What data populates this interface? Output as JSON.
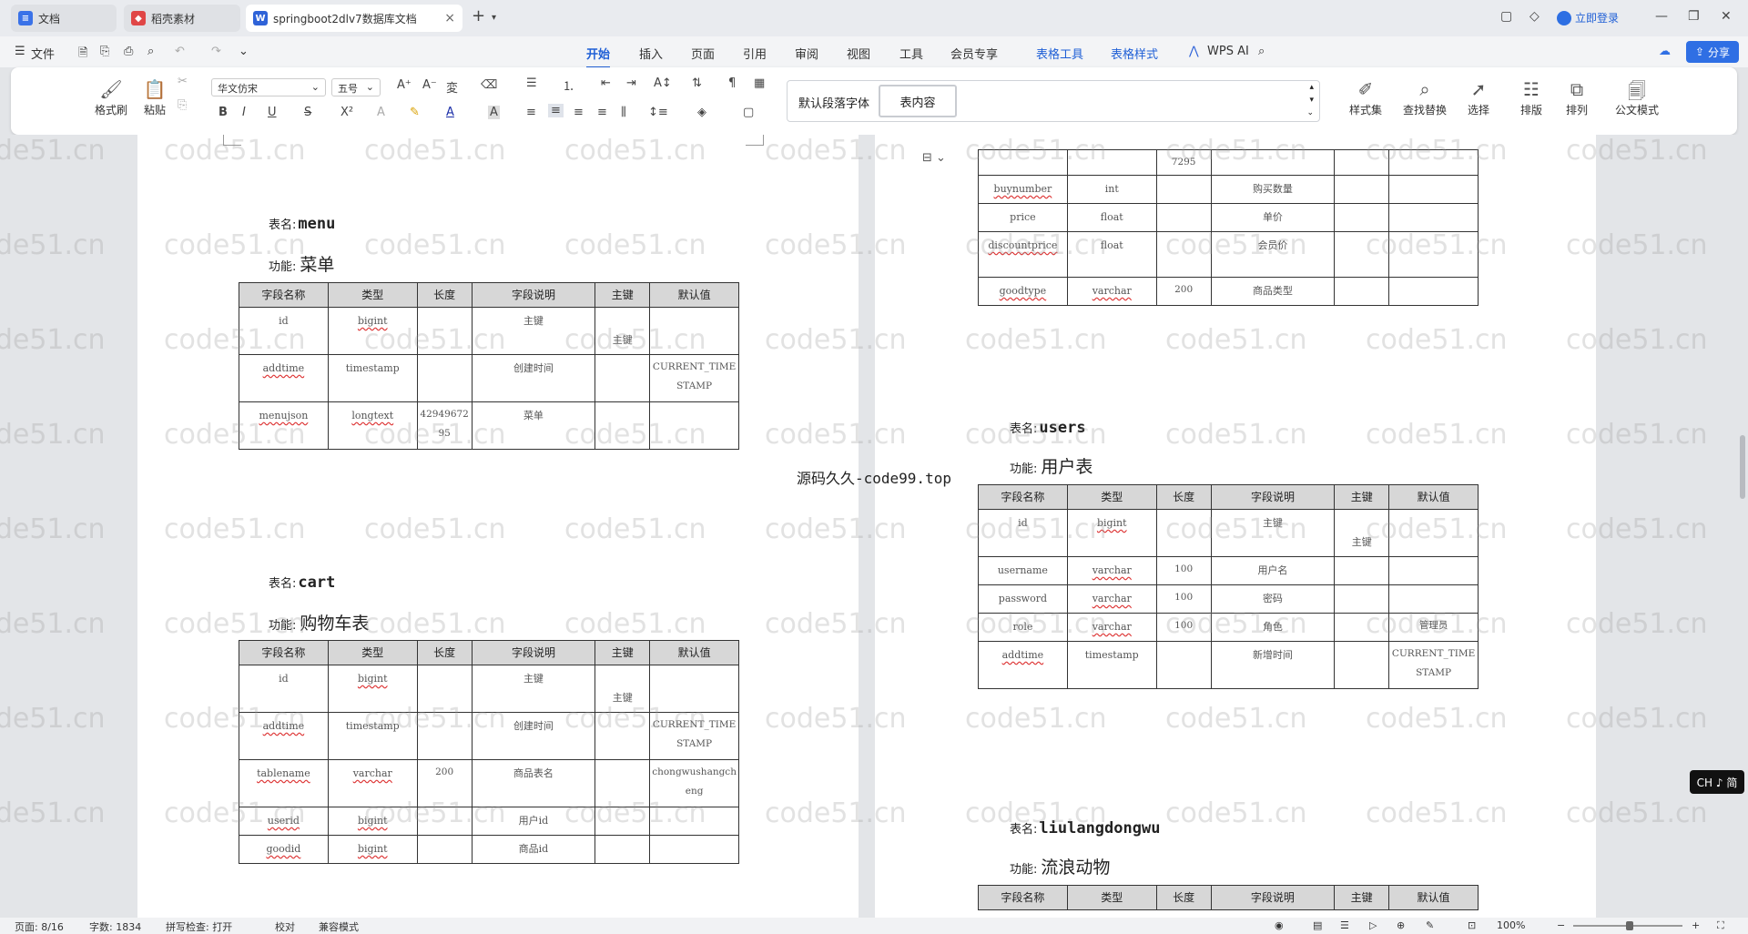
{
  "tabs": [
    {
      "label": "文档",
      "icon": "docs-icon",
      "color": "#3a72e8"
    },
    {
      "label": "稻壳素材",
      "icon": "docer-icon",
      "color": "#e04646"
    },
    {
      "label": "springboot2dlv7数据库文档",
      "icon": "word-icon",
      "color": "#2f63d8"
    }
  ],
  "titlebar": {
    "login": "立即登录"
  },
  "menu": {
    "file": "文件",
    "items": [
      "开始",
      "插入",
      "页面",
      "引用",
      "审阅",
      "视图",
      "工具",
      "会员专享",
      "表格工具",
      "表格样式"
    ],
    "wps_ai": "WPS AI",
    "share": "分享"
  },
  "ribbon": {
    "format_painter": "格式刷",
    "paste": "粘贴",
    "font_name": "华文仿宋",
    "font_size": "五号",
    "default_para_font": "默认段落字体",
    "table_content": "表内容",
    "styles": "样式集",
    "find_replace": "查找替换",
    "select": "选择",
    "layout": "排版",
    "arrange": "排列",
    "official_mode": "公文模式"
  },
  "watermark": "code51.cn",
  "middle_text": "源码久久-code99.top",
  "headers": [
    "字段名称",
    "类型",
    "长度",
    "字段说明",
    "主键",
    "默认值"
  ],
  "labels": {
    "table_name": "表名:",
    "function": "功能:"
  },
  "left": {
    "menu": {
      "name": "menu",
      "func": "菜单",
      "rows": [
        [
          "id",
          "bigint",
          "",
          "主键",
          "主键",
          ""
        ],
        [
          "addtime",
          "timestamp",
          "",
          "创建时间",
          "",
          "CURRENT_TIMESTAMP"
        ],
        [
          "menujson",
          "longtext",
          "4294967295",
          "菜单",
          "",
          ""
        ]
      ]
    },
    "cart": {
      "name": "cart",
      "func": "购物车表",
      "rows": [
        [
          "id",
          "bigint",
          "",
          "主键",
          "主键",
          ""
        ],
        [
          "addtime",
          "timestamp",
          "",
          "创建时间",
          "",
          "CURRENT_TIMESTAMP"
        ],
        [
          "tablename",
          "varchar",
          "200",
          "商品表名",
          "",
          "chongwushangcheng"
        ],
        [
          "userid",
          "bigint",
          "",
          "用户id",
          "",
          ""
        ],
        [
          "goodid",
          "bigint",
          "",
          "商品id",
          "",
          ""
        ]
      ]
    }
  },
  "right": {
    "cont": {
      "rows": [
        [
          "",
          "",
          "7295",
          "",
          "",
          ""
        ],
        [
          "buynumber",
          "int",
          "",
          "购买数量",
          "",
          ""
        ],
        [
          "price",
          "float",
          "",
          "单价",
          "",
          ""
        ],
        [
          "discountprice",
          "float",
          "",
          "会员价",
          "",
          ""
        ],
        [
          "goodtype",
          "varchar",
          "200",
          "商品类型",
          "",
          ""
        ]
      ]
    },
    "users": {
      "name": "users",
      "func": "用户表",
      "rows": [
        [
          "id",
          "bigint",
          "",
          "主键",
          "主键",
          ""
        ],
        [
          "username",
          "varchar",
          "100",
          "用户名",
          "",
          ""
        ],
        [
          "password",
          "varchar",
          "100",
          "密码",
          "",
          ""
        ],
        [
          "role",
          "varchar",
          "100",
          "角色",
          "",
          "管理员"
        ],
        [
          "addtime",
          "timestamp",
          "",
          "新增时间",
          "",
          "CURRENT_TIMESTAMP"
        ]
      ]
    },
    "liulang": {
      "name": "liulangdongwu",
      "func": "流浪动物"
    }
  },
  "status": {
    "page": "页面: 8/16",
    "words": "字数: 1834",
    "spell": "拼写检查: 打开",
    "proof": "校对",
    "compat": "兼容模式",
    "zoom": "100%"
  },
  "ime": "CH ♪ 简"
}
